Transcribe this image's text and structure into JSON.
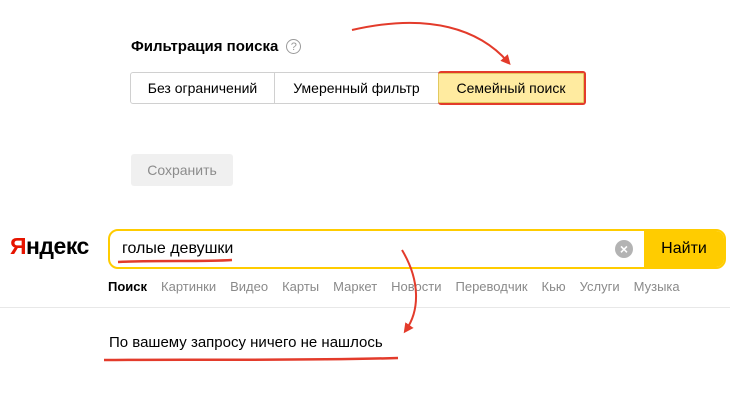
{
  "filter": {
    "title": "Фильтрация поиска",
    "help_glyph": "?",
    "options": [
      {
        "label": "Без ограничений",
        "selected": false
      },
      {
        "label": "Умеренный фильтр",
        "selected": false
      },
      {
        "label": "Семейный поиск",
        "selected": true
      }
    ],
    "save_label": "Сохранить"
  },
  "logo": {
    "first_letter": "Я",
    "rest": "ндекс"
  },
  "search": {
    "query": "голые девушки",
    "clear_glyph": "×",
    "button_label": "Найти"
  },
  "services": [
    {
      "label": "Поиск",
      "active": true
    },
    {
      "label": "Картинки",
      "active": false
    },
    {
      "label": "Видео",
      "active": false
    },
    {
      "label": "Карты",
      "active": false
    },
    {
      "label": "Маркет",
      "active": false
    },
    {
      "label": "Новости",
      "active": false
    },
    {
      "label": "Переводчик",
      "active": false
    },
    {
      "label": "Кью",
      "active": false
    },
    {
      "label": "Услуги",
      "active": false
    },
    {
      "label": "Музыка",
      "active": false
    }
  ],
  "results": {
    "no_results_text": "По вашему запросу ничего не нашлось"
  },
  "colors": {
    "accent_yellow": "#ffcc00",
    "selected_bg": "#ffeba0",
    "annotation_red": "#e33b2b",
    "logo_red": "#e61400"
  }
}
